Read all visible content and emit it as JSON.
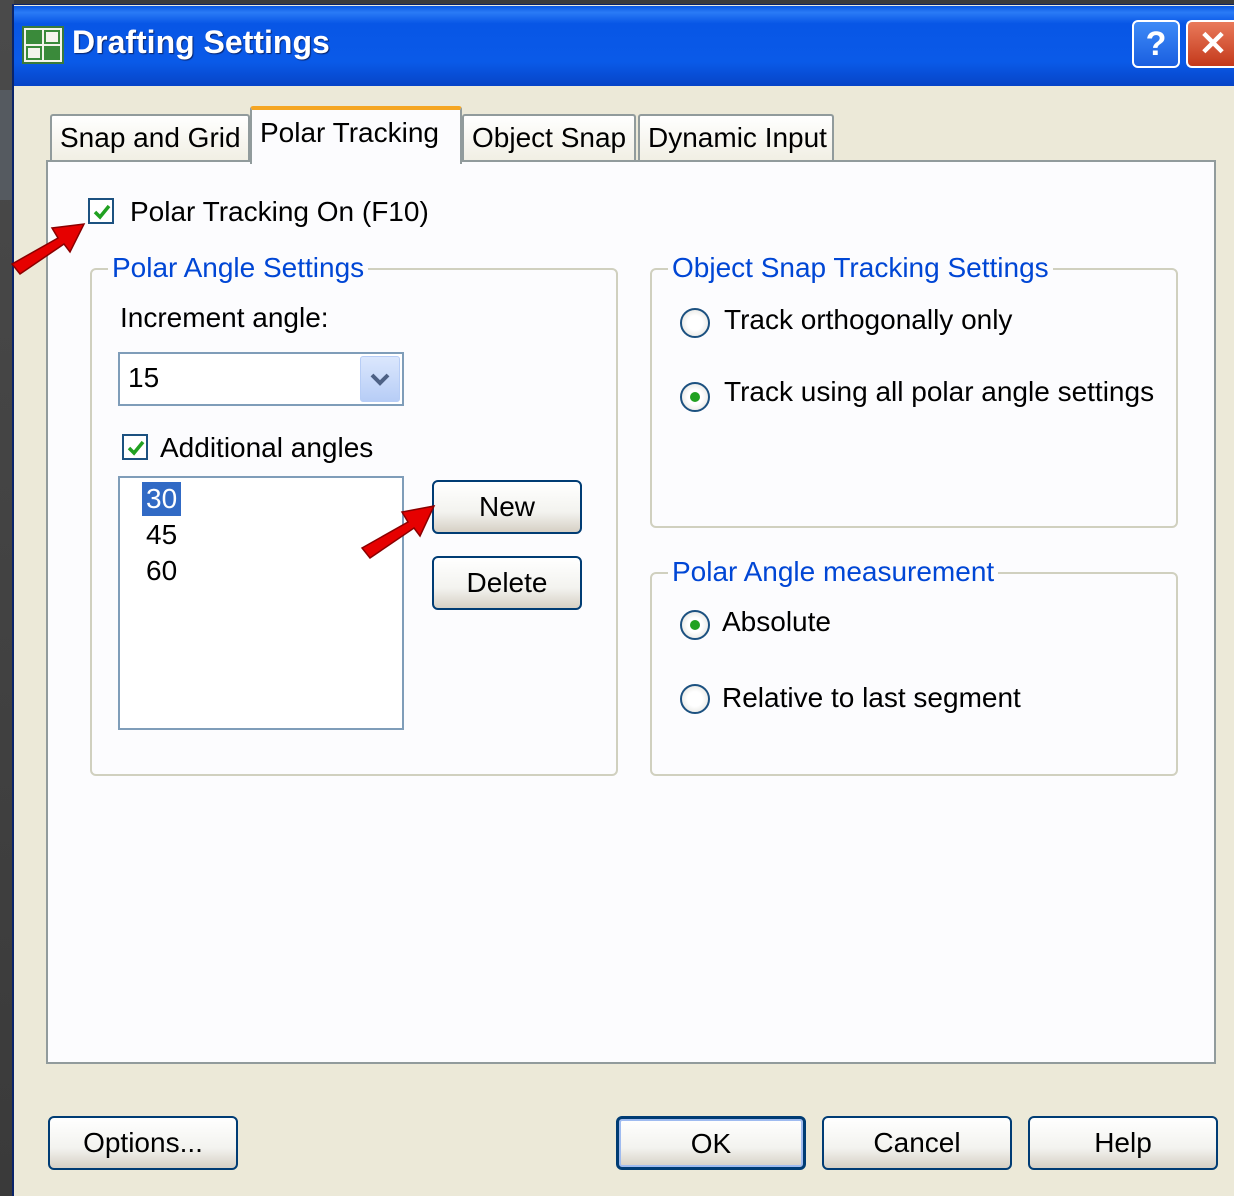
{
  "window": {
    "title": "Drafting Settings",
    "help_button": "?",
    "close_button": "✕"
  },
  "tabs": [
    {
      "label": "Snap and Grid",
      "active": false
    },
    {
      "label": "Polar Tracking",
      "active": true
    },
    {
      "label": "Object Snap",
      "active": false
    },
    {
      "label": "Dynamic Input",
      "active": false
    }
  ],
  "polar_tracking": {
    "enabled_label": "Polar Tracking On (F10)",
    "enabled_checked": true
  },
  "polar_angle_settings": {
    "legend": "Polar Angle Settings",
    "increment_label": "Increment angle:",
    "increment_value": "15",
    "additional_label": "Additional angles",
    "additional_checked": true,
    "angles": [
      "30",
      "45",
      "60"
    ],
    "selected_angle": "30",
    "new_button": "New",
    "delete_button": "Delete"
  },
  "object_snap_tracking": {
    "legend": "Object Snap Tracking Settings",
    "options": [
      {
        "label": "Track orthogonally only",
        "selected": false
      },
      {
        "label": "Track using all polar angle settings",
        "selected": true
      }
    ]
  },
  "polar_angle_measurement": {
    "legend": "Polar Angle measurement",
    "options": [
      {
        "label": "Absolute",
        "selected": true
      },
      {
        "label": "Relative to last segment",
        "selected": false
      }
    ]
  },
  "footer": {
    "options_button": "Options...",
    "ok_button": "OK",
    "cancel_button": "Cancel",
    "help_button": "Help"
  },
  "colors": {
    "titlebar": "#0a5ae8",
    "dialog_bg": "#ece9d8",
    "legend_text": "#0046d5",
    "selection": "#316ac5",
    "annotation_arrow": "#e60000"
  }
}
